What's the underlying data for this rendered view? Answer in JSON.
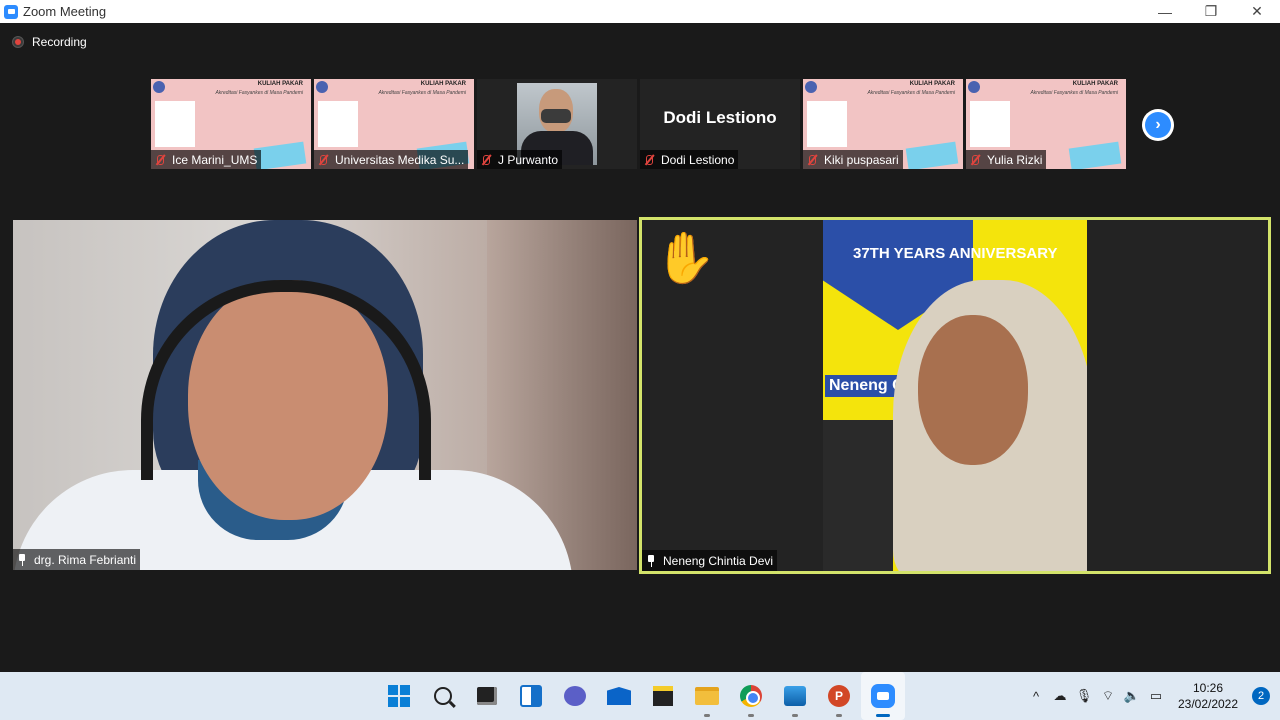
{
  "window": {
    "title": "Zoom Meeting",
    "controls": {
      "minimize": "—",
      "maximize": "❐",
      "close": "✕"
    }
  },
  "recording": {
    "label": "Recording"
  },
  "strip": {
    "participants": [
      {
        "name": "Ice Marini_UMS",
        "kind": "slide",
        "muted": true
      },
      {
        "name": "Universitas Medika Su...",
        "kind": "slide",
        "muted": true
      },
      {
        "name": "J Purwanto",
        "kind": "video",
        "muted": true
      },
      {
        "name": "Dodi Lestiono",
        "kind": "name",
        "display_name": "Dodi Lestiono",
        "muted": true
      },
      {
        "name": "Kiki puspasari",
        "kind": "slide",
        "muted": true
      },
      {
        "name": "Yulia Rizki",
        "kind": "slide",
        "muted": true
      }
    ],
    "slide_title": "KULIAH PAKAR",
    "slide_subtitle": "Akreditasi Fasyankes di Masa Pandemi",
    "next_label": "›"
  },
  "main": {
    "left": {
      "name": "drg. Rima Febrianti"
    },
    "right": {
      "name": "Neneng Chintia Devi",
      "raise_hand": "✋",
      "banner": "37TH YEARS ANNIVERSARY",
      "bg_text": "Neneng C"
    }
  },
  "colors": {
    "accent": "#2d8cff",
    "active_speaker": "#d3e36a",
    "muted": "#e0443e"
  },
  "taskbar": {
    "apps": [
      "windows-start",
      "search",
      "task-view",
      "widgets",
      "chat",
      "mail",
      "sticky-notes",
      "file-explorer",
      "chrome",
      "photos",
      "powerpoint",
      "zoom"
    ],
    "tray": {
      "chevron": "^",
      "time": "10:26",
      "date": "23/02/2022",
      "notifications": "2"
    }
  }
}
